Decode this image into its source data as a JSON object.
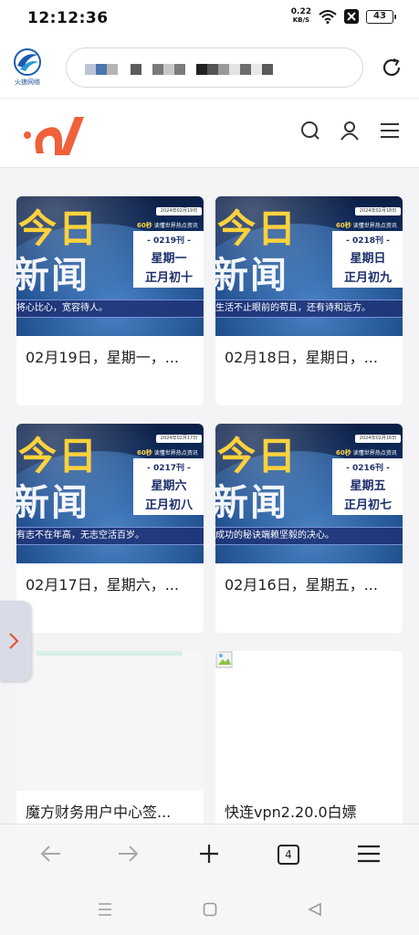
{
  "status_bar": {
    "time": "12:12:36",
    "net_speed_value": "0.22",
    "net_speed_unit": "KB/S",
    "battery": "43",
    "icons": [
      "wifi-icon",
      "mute-icon",
      "battery-icon"
    ]
  },
  "browser": {
    "site_logo_text": "火狼网络",
    "url_display": "blurred",
    "reload_icon": "reload-icon"
  },
  "site_header": {
    "logo": "brand-logo",
    "brand_color": "#f0603a",
    "icons": [
      "search-icon",
      "user-icon",
      "menu-icon"
    ]
  },
  "cards": [
    {
      "title": "02月19日，星期一，...",
      "thumb": {
        "big1": "今日",
        "big2": "新闻",
        "tag": "60秒",
        "tag_sub": "读懂世界热点资讯",
        "date": "2024年02月19日",
        "issue": "- 0219刊 -",
        "weekday": "星期一",
        "lunar": "正月初十",
        "quote": "将心比心，宽容待人。"
      }
    },
    {
      "title": "02月18日，星期日，...",
      "thumb": {
        "big1": "今日",
        "big2": "新闻",
        "tag": "60秒",
        "tag_sub": "读懂世界热点资讯",
        "date": "2024年02月18日",
        "issue": "- 0218刊 -",
        "weekday": "星期日",
        "lunar": "正月初九",
        "quote": "生活不止眼前的苟且，还有诗和远方。"
      }
    },
    {
      "title": "02月17日，星期六，...",
      "thumb": {
        "big1": "今日",
        "big2": "新闻",
        "tag": "60秒",
        "tag_sub": "读懂世界热点资讯",
        "date": "2024年02月17日",
        "issue": "- 0217刊 -",
        "weekday": "星期六",
        "lunar": "正月初八",
        "quote": "有志不在年高，无志空活百岁。"
      }
    },
    {
      "title": "02月16日，星期五，...",
      "thumb": {
        "big1": "今日",
        "big2": "新闻",
        "tag": "60秒",
        "tag_sub": "读懂世界热点资讯",
        "date": "2024年02月16日",
        "issue": "- 0216刊 -",
        "weekday": "星期五",
        "lunar": "正月初七",
        "quote": "成功的秘诀端赖坚毅的决心。"
      }
    },
    {
      "title": "魔方财务用户中心签..."
    },
    {
      "title": "快连vpn2.20.0白嫖"
    }
  ],
  "bottom_toolbar": {
    "tabs_count": "4",
    "icons": [
      "back-icon",
      "forward-icon",
      "new-tab-icon",
      "tabs-icon",
      "menu-icon"
    ]
  },
  "system_nav": {
    "icons": [
      "recents-icon",
      "home-icon",
      "back-icon"
    ]
  }
}
